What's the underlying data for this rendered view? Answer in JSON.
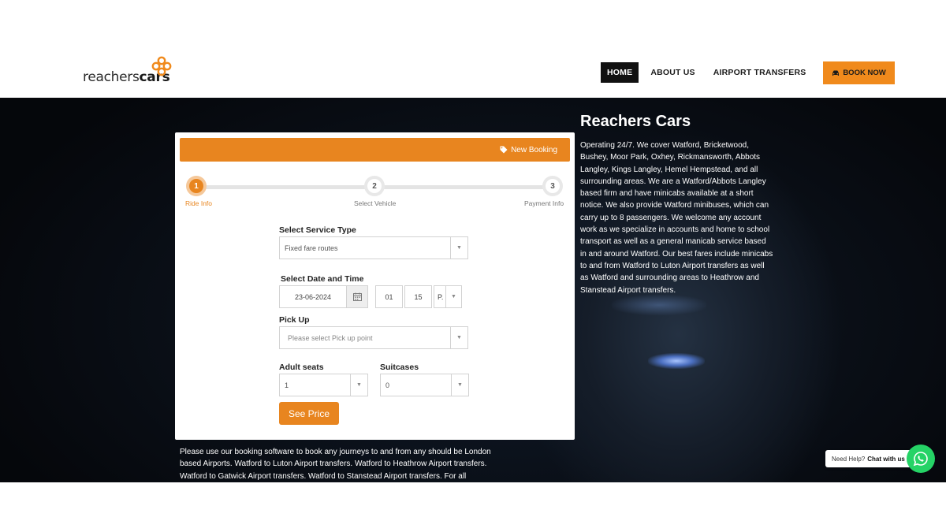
{
  "brand": {
    "logo_light": "reachers",
    "logo_bold": "cars"
  },
  "nav": {
    "items": [
      {
        "label": "HOME",
        "active": true
      },
      {
        "label": "ABOUT US",
        "active": false
      },
      {
        "label": "AIRPORT TRANSFERS",
        "active": false
      }
    ],
    "book_now": "BOOK NOW"
  },
  "booking": {
    "header_label": "New Booking",
    "steps": [
      {
        "number": "1",
        "label": "Ride Info",
        "active": true
      },
      {
        "number": "2",
        "label": "Select Vehicle",
        "active": false
      },
      {
        "number": "3",
        "label": "Payment Info",
        "active": false
      }
    ],
    "service_type": {
      "label": "Select Service Type",
      "value": "Fixed fare routes"
    },
    "date_time": {
      "label": "Select Date and Time",
      "date": "23-06-2024",
      "hour": "01",
      "minute": "15",
      "ampm": "P..."
    },
    "pickup": {
      "label": "Pick Up",
      "placeholder": "Please select Pick up point"
    },
    "adult_seats": {
      "label": "Adult seats",
      "value": "1"
    },
    "suitcases": {
      "label": "Suitcases",
      "value": "0"
    },
    "see_price": "See Price"
  },
  "below_text": "Please use our booking software to book any journeys to and from any should be London based Airports. Watford to Luton Airport transfers. Watford to Heathrow Airport transfers. Watford to Gatwick Airport transfers. Watford to Stanstead Airport transfers. For all",
  "info": {
    "title": "Reachers Cars",
    "text": "Operating 24/7. We cover Watford, Bricketwood, Bushey, Moor Park, Oxhey, Rickmansworth, Abbots Langley, Kings Langley, Hemel Hempstead, and all surrounding areas. We are a Watford/Abbots Langley based firm and have minicabs available at a short notice. We also provide Watford minibuses, which can carry up to 8 passengers. We welcome any account work as we specialize in accounts and home to school transport as well as a general manicab service based in and around Watford. Our best fares include minicabs to and from Watford to Luton Airport transfers as well as Watford and surrounding areas to Heathrow and Stanstead Airport transfers."
  },
  "help": {
    "prefix": "Need Help?",
    "cta": "Chat with us"
  },
  "colors": {
    "accent": "#e8851f",
    "nav_active_bg": "#111111",
    "whatsapp": "#25d366"
  },
  "icons": [
    "logo-mark-icon",
    "car-icon",
    "tag-icon",
    "calendar-icon",
    "chevron-down-icon",
    "whatsapp-icon"
  ]
}
